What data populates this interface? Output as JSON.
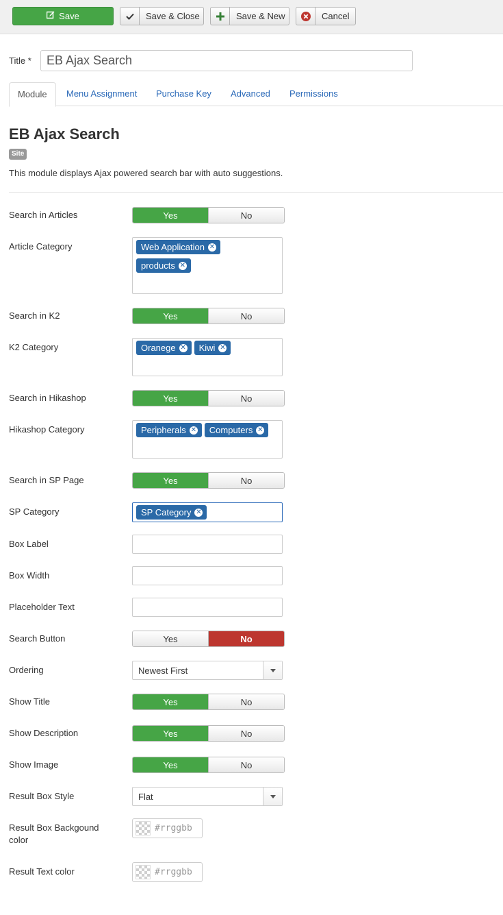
{
  "toolbar": {
    "save_label": "Save",
    "save_close_label": "Save & Close",
    "save_new_label": "Save & New",
    "cancel_label": "Cancel",
    "colors": {
      "save_bg": "#46a546",
      "cancel_icon": "#bd362f",
      "new_icon": "#46a546"
    }
  },
  "title": {
    "label": "Title *",
    "value": "EB Ajax Search"
  },
  "tabs": [
    {
      "label": "Module",
      "active": true
    },
    {
      "label": "Menu Assignment",
      "active": false
    },
    {
      "label": "Purchase Key",
      "active": false
    },
    {
      "label": "Advanced",
      "active": false
    },
    {
      "label": "Permissions",
      "active": false
    }
  ],
  "module": {
    "name": "EB Ajax Search",
    "badge": "Site",
    "description": "This module displays Ajax powered search bar with auto suggestions."
  },
  "fields": {
    "search_articles": {
      "label": "Search in Articles",
      "yes": "Yes",
      "no": "No",
      "value": "Yes"
    },
    "article_category": {
      "label": "Article Category",
      "tags": [
        "Web Application",
        "products"
      ]
    },
    "search_k2": {
      "label": "Search in K2",
      "yes": "Yes",
      "no": "No",
      "value": "Yes"
    },
    "k2_category": {
      "label": "K2 Category",
      "tags": [
        "Oranege",
        "Kiwi"
      ]
    },
    "search_hikashop": {
      "label": "Search in Hikashop",
      "yes": "Yes",
      "no": "No",
      "value": "Yes"
    },
    "hikashop_category": {
      "label": "Hikashop Category",
      "tags": [
        "Peripherals",
        "Computers"
      ]
    },
    "search_sp": {
      "label": "Search in SP Page",
      "yes": "Yes",
      "no": "No",
      "value": "Yes"
    },
    "sp_category": {
      "label": "SP Category",
      "tags": [
        "SP Category"
      ]
    },
    "box_label": {
      "label": "Box Label",
      "value": ""
    },
    "box_width": {
      "label": "Box Width",
      "value": ""
    },
    "placeholder_text": {
      "label": "Placeholder Text",
      "value": ""
    },
    "search_button": {
      "label": "Search Button",
      "yes": "Yes",
      "no": "No",
      "value": "No"
    },
    "ordering": {
      "label": "Ordering",
      "value": "Newest First"
    },
    "show_title": {
      "label": "Show Title",
      "yes": "Yes",
      "no": "No",
      "value": "Yes"
    },
    "show_description": {
      "label": "Show Description",
      "yes": "Yes",
      "no": "No",
      "value": "Yes"
    },
    "show_image": {
      "label": "Show Image",
      "yes": "Yes",
      "no": "No",
      "value": "Yes"
    },
    "result_box_style": {
      "label": "Result Box Style",
      "value": "Flat"
    },
    "result_box_bg": {
      "label_line1": "Result Box Backgound",
      "label_line2": "color",
      "placeholder": "#rrggbb"
    },
    "result_text_color": {
      "label": "Result Text color",
      "placeholder": "#rrggbb"
    }
  },
  "colors": {
    "yes_active": "#46a546",
    "no_active": "#bd362f",
    "chip": "#2a69a7",
    "link": "#2a69b8"
  }
}
